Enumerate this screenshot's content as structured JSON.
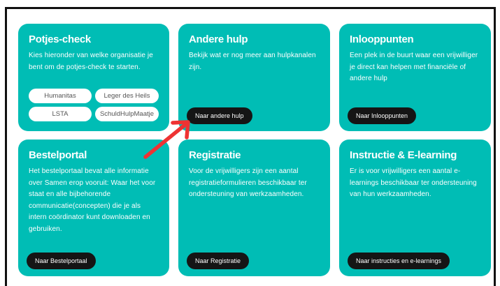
{
  "cards": [
    {
      "title": "Potjes-check",
      "desc": "Kies hieronder van welke organisatie je bent om de potjes-check te starten.",
      "options": [
        "Humanitas",
        "Leger des Heils",
        "LSTA",
        "SchuldHulpMaatje"
      ]
    },
    {
      "title": "Andere hulp",
      "desc": "Bekijk wat er nog meer aan hulpkanalen zijn.",
      "button": "Naar andere hulp"
    },
    {
      "title": "Inlooppunten",
      "desc": "Een plek in de buurt waar een vrijwilliger je direct kan helpen met financiële of andere hulp",
      "button": "Naar Inlooppunten"
    },
    {
      "title": "Bestelportal",
      "desc": "Het bestelportaal bevat alle informatie over Samen erop vooruit: Waar het voor staat en alle bijbehorende communicatie(concepten) die je als intern coördinator kunt downloaden en gebruiken.",
      "button": "Naar Bestelportaal"
    },
    {
      "title": "Registratie",
      "desc": "Voor de vrijwilligers zijn een aantal registratieformulieren beschikbaar ter ondersteuning van werkzaamheden.",
      "button": "Naar Registratie"
    },
    {
      "title": "Instructie & E-learning",
      "desc": "Er is voor vrijwilligers een aantal e-learnings beschikbaar ter ondersteuning van hun werkzaamheden.",
      "button": "Naar instructies en e-learnings"
    }
  ],
  "colors": {
    "card": "#00bdb5",
    "button": "#151515",
    "arrow": "#ee3333",
    "border": "#111111"
  },
  "annotation": {
    "icon": "red-arrow-icon"
  }
}
